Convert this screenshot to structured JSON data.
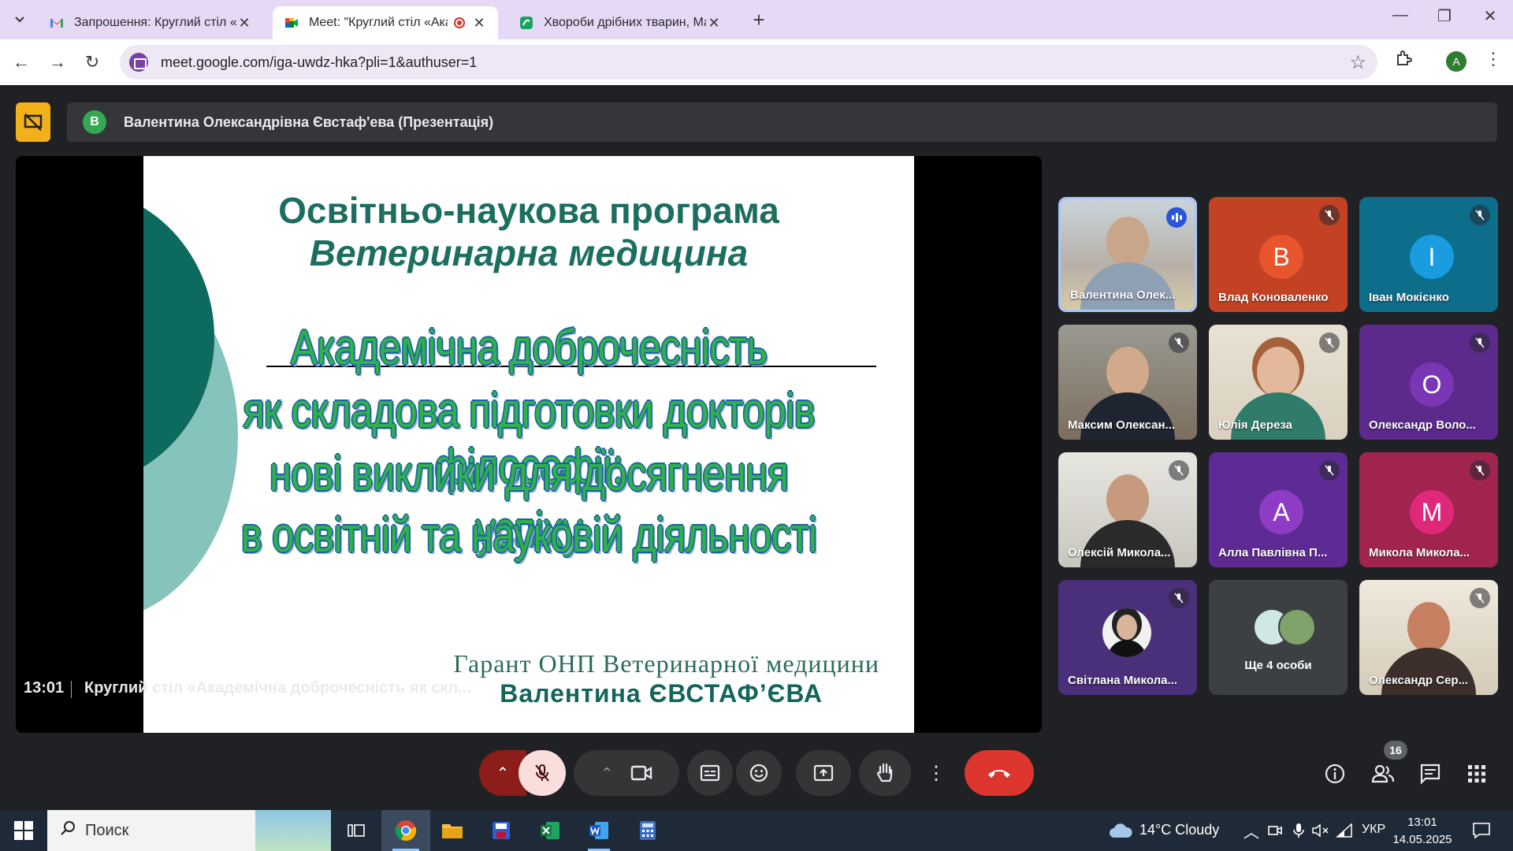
{
  "browser": {
    "tabs": [
      {
        "title": "Запрошення: Круглий стіл «Ак",
        "favicon": "gmail-icon"
      },
      {
        "title": "Meet: \"Круглий стіл «Акаде",
        "favicon": "meet-icon",
        "active": true
      },
      {
        "title": "Хвороби дрібних тварин, Магі",
        "favicon": "sheets-icon"
      }
    ],
    "url": "meet.google.com/iga-uwdz-hka?pli=1&authuser=1",
    "profile_initial": "A"
  },
  "meet": {
    "presenter": {
      "initial": "B",
      "name": "Валентина Олександрівна Євстаф'ева (Презентація)"
    },
    "slide": {
      "program_line1": "Освітньо-наукова програма",
      "program_line2": "Ветеринарна медицина",
      "main_line1": "Академічна доброчесність",
      "main_line2": "як складова підготовки докторів філософії:",
      "main_line3": "нові виклики для досягнення успіху",
      "main_line4": "в освітній та науковій діяльності",
      "guarantor": "Гарант ОНП Ветеринарної медицини",
      "author": "Валентина ЄВСТАФ’ЄВА"
    },
    "participants": [
      {
        "name": "Валентина Олек...",
        "type": "video",
        "speaking": true
      },
      {
        "name": "Влад Коноваленко",
        "initial": "B",
        "color": "#e8542c",
        "bg": "#c34224",
        "muted": true
      },
      {
        "name": "Іван Мокієнко",
        "initial": "I",
        "color": "#1a9ce0",
        "bg": "#0d6e8c",
        "muted": true
      },
      {
        "name": "Максим Олексан...",
        "type": "video",
        "muted": true
      },
      {
        "name": "Юлія Дереза",
        "type": "video",
        "muted": true
      },
      {
        "name": "Олександр Воло...",
        "initial": "O",
        "color": "#7a36b5",
        "bg": "#5b2a8c",
        "muted": true
      },
      {
        "name": "Олексій Микола...",
        "type": "video",
        "muted": true
      },
      {
        "name": "Алла Павлівна П...",
        "initial": "A",
        "color": "#8e3cc6",
        "bg": "#5e2b95",
        "muted": true
      },
      {
        "name": "Микола Микола...",
        "initial": "M",
        "color": "#e0287a",
        "bg": "#a0244e",
        "muted": true
      },
      {
        "name": "Світлана Микола...",
        "type": "video",
        "muted": true
      },
      {
        "name": "Ще 4 особи",
        "type": "more"
      },
      {
        "name": "Олександр Сер...",
        "type": "video",
        "muted": true
      }
    ],
    "time": "13:01",
    "meeting_title": "Круглий стіл «Академічна доброчесність як скл...",
    "participant_count": "16"
  },
  "taskbar": {
    "search_placeholder": "Поиск",
    "weather": "14°C  Cloudy",
    "language": "УКР",
    "time": "13:01",
    "date": "14.05.2025"
  }
}
